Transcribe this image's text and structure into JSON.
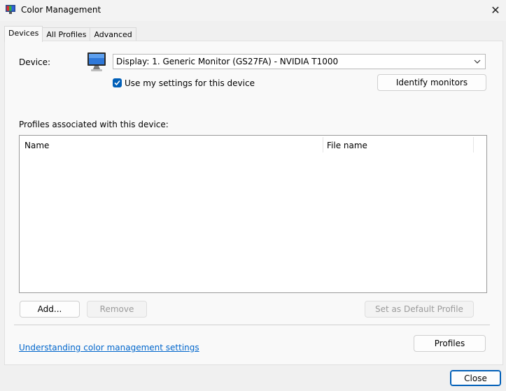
{
  "window": {
    "title": "Color Management",
    "close_glyph": "✕"
  },
  "tabs": [
    {
      "label": "Devices",
      "active": true
    },
    {
      "label": "All Profiles",
      "active": false
    },
    {
      "label": "Advanced",
      "active": false
    }
  ],
  "devices": {
    "device_label": "Device:",
    "device_value": "Display: 1. Generic Monitor (GS27FA) - NVIDIA T1000",
    "use_my_settings_label": "Use my settings for this device",
    "use_my_settings_checked": true,
    "identify_button": "Identify monitors",
    "profiles_label": "Profiles associated with this device:",
    "columns": [
      "Name",
      "File name"
    ],
    "rows": [],
    "add_button": "Add...",
    "remove_button": "Remove",
    "set_default_button": "Set as Default Profile",
    "link_text": "Understanding color management settings",
    "profiles_button": "Profiles"
  },
  "footer": {
    "close_button": "Close"
  },
  "colors": {
    "accent": "#005fb8",
    "link": "#0066cc"
  },
  "icons": {
    "app": "color-management-icon",
    "device": "monitor-icon"
  }
}
